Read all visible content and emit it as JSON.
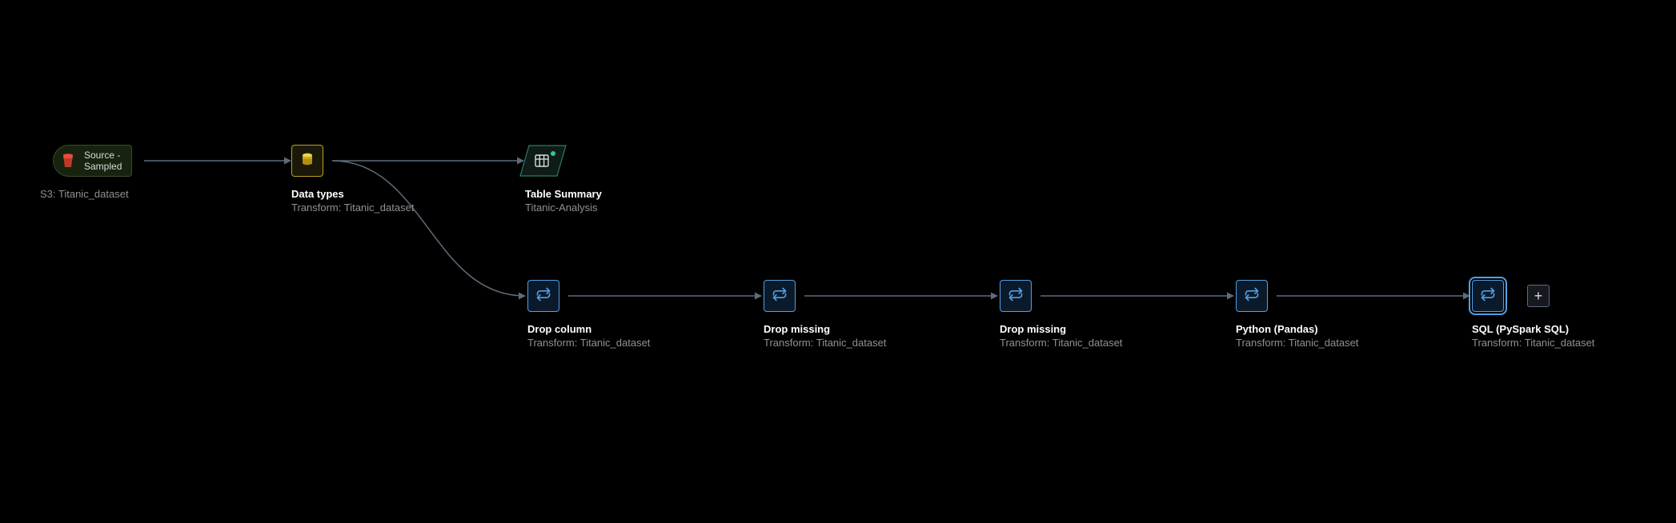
{
  "nodes": {
    "source": {
      "pill_line1": "Source -",
      "pill_line2": "Sampled",
      "subtitle": "S3: Titanic_dataset"
    },
    "datatypes": {
      "title": "Data types",
      "subtitle": "Transform: Titanic_dataset"
    },
    "summary": {
      "title": "Table Summary",
      "subtitle": "Titanic-Analysis"
    },
    "dropcolumn": {
      "title": "Drop column",
      "subtitle": "Transform: Titanic_dataset"
    },
    "dropmissing1": {
      "title": "Drop missing",
      "subtitle": "Transform: Titanic_dataset"
    },
    "dropmissing2": {
      "title": "Drop missing",
      "subtitle": "Transform: Titanic_dataset"
    },
    "python": {
      "title": "Python (Pandas)",
      "subtitle": "Transform: Titanic_dataset"
    },
    "sql": {
      "title": "SQL (PySpark SQL)",
      "subtitle": "Transform: Titanic_dataset"
    }
  },
  "add_button": {
    "label": "+"
  }
}
